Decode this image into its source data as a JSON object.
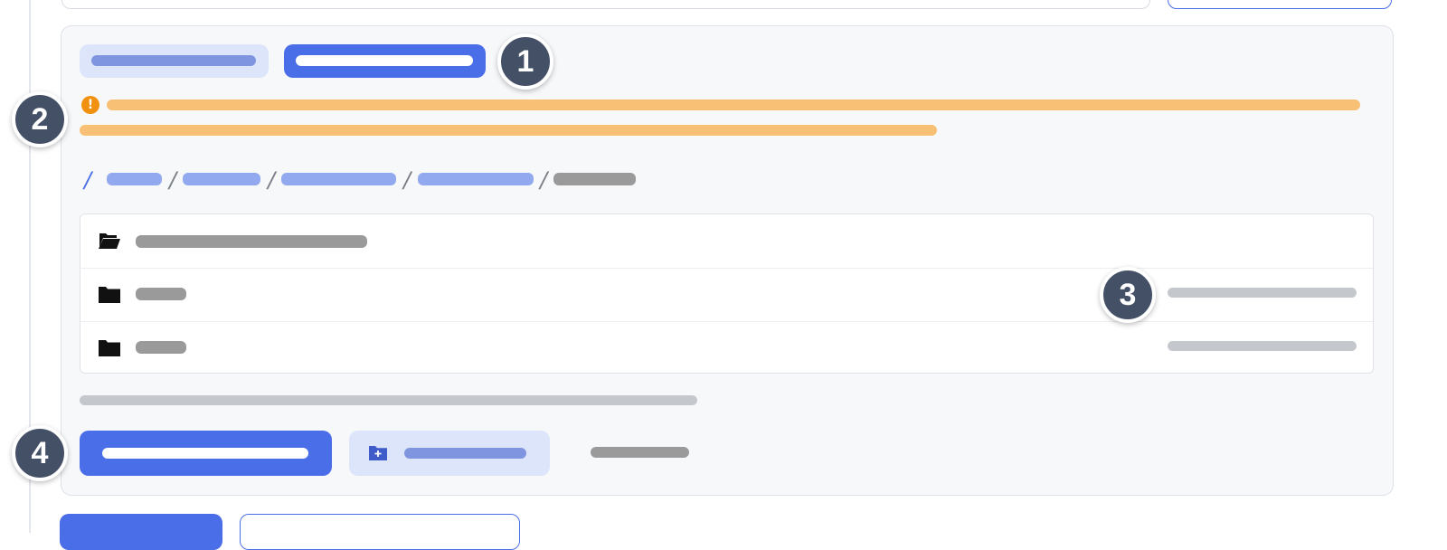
{
  "markers": [
    "1",
    "2",
    "3",
    "4"
  ],
  "alert": {
    "icon": "exclamation-circle-icon",
    "icon_glyph": "!",
    "color": "#f0920f"
  },
  "breadcrumb": {
    "separator": "/"
  },
  "icons": {
    "open_folder": "folder-open-icon",
    "folder": "folder-icon",
    "new_folder": "folder-plus-icon"
  },
  "colors": {
    "accent": "#4a6ee8",
    "accent_light": "#dde5fb",
    "warning_bar": "#f7c074",
    "marker": "#445066"
  }
}
